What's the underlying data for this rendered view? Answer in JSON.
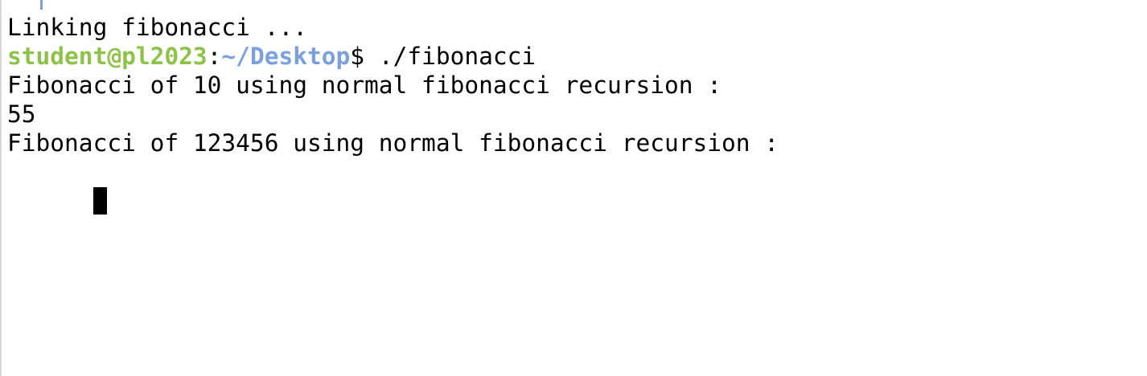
{
  "terminal": {
    "lines": {
      "l0": "Linking fibonacci ...",
      "prompt": {
        "user_host": "student@pl2023",
        "colon": ":",
        "path": "~/Desktop",
        "symbol": "$ ",
        "command": "./fibonacci"
      },
      "l2": "Fibonacci of 10 using normal fibonacci recursion :",
      "l3": "55",
      "l4": "Fibonacci of 123456 using normal fibonacci recursion :"
    },
    "colors": {
      "user_host": "#8ec34a",
      "path": "#7aa0de",
      "text": "#000000",
      "background": "#ffffff"
    },
    "cursor_icon": "block-cursor"
  }
}
